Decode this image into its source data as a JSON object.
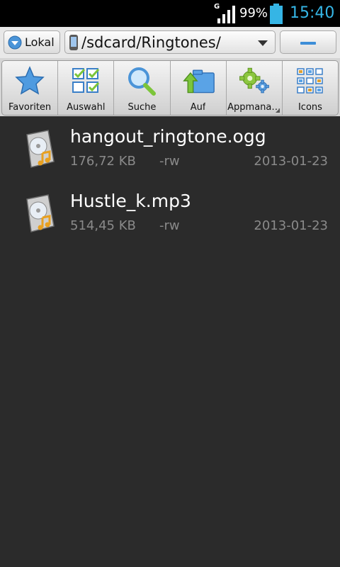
{
  "status_bar": {
    "network": "G",
    "battery_percent": "99%",
    "battery_level": 0.99,
    "time": "15:40",
    "time_color": "#35b5e5",
    "icons": [
      "signal-icon",
      "battery-icon"
    ]
  },
  "address_bar": {
    "location_button": "Lokal",
    "path": "/sdcard/Ringtones/",
    "accent": "#3d8ed8"
  },
  "toolbar": {
    "items": [
      {
        "label": "Favoriten",
        "icon": "star-icon"
      },
      {
        "label": "Auswahl",
        "icon": "checklist-icon"
      },
      {
        "label": "Suche",
        "icon": "search-icon"
      },
      {
        "label": "Auf",
        "icon": "up-folder-icon"
      },
      {
        "label": "Appmana…",
        "icon": "gears-icon"
      },
      {
        "label": "Icons",
        "icon": "grid-icon"
      }
    ]
  },
  "files": [
    {
      "name": "hangout_ringtone.ogg",
      "size": "176,72 KB",
      "permissions": "-rw",
      "date": "2013-01-23",
      "icon": "audio-file-icon"
    },
    {
      "name": "Hustle_k.mp3",
      "size": "514,45 KB",
      "permissions": "-rw",
      "date": "2013-01-23",
      "icon": "audio-file-icon"
    }
  ]
}
